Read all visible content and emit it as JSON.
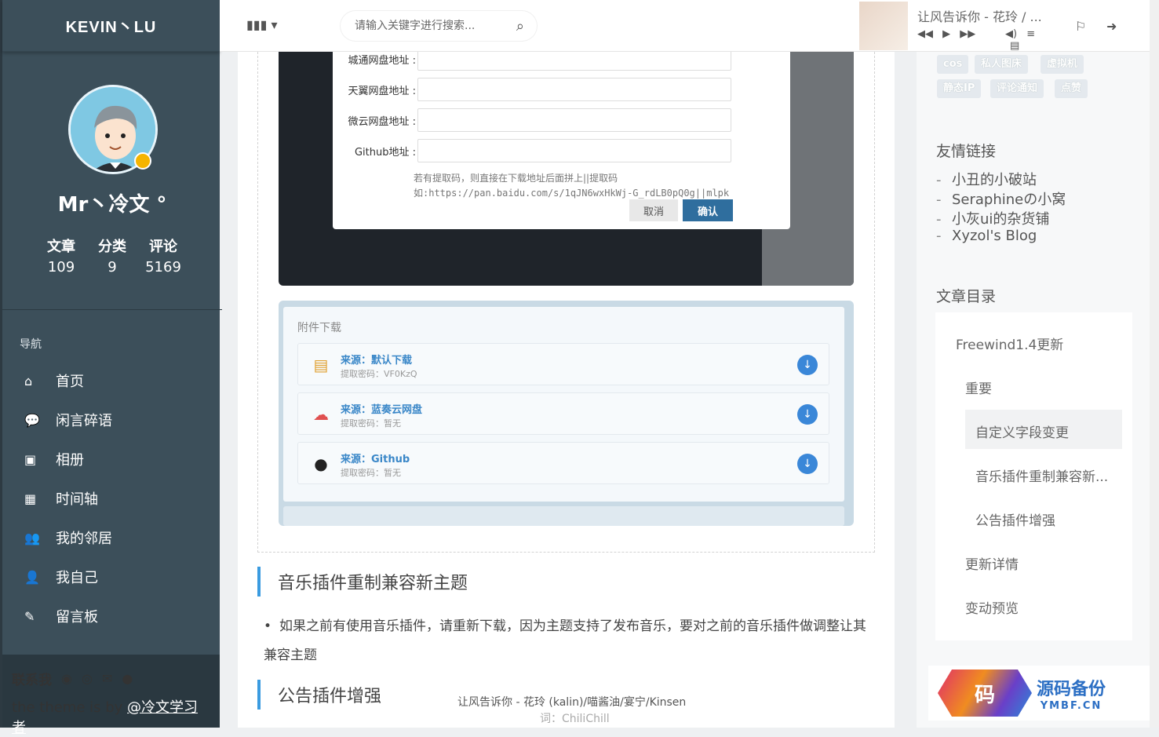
{
  "sidebar": {
    "brand": "KEVIN丶LU",
    "username": "Mr丶冷文 °",
    "stats": [
      {
        "label": "文章",
        "value": "109"
      },
      {
        "label": "分类",
        "value": "9"
      },
      {
        "label": "评论",
        "value": "5169"
      }
    ],
    "nav_heading": "导航",
    "nav": [
      {
        "label": "首页",
        "icon": "home-icon",
        "glyph": "⌂"
      },
      {
        "label": "闲言碎语",
        "icon": "comment-icon",
        "glyph": "💬"
      },
      {
        "label": "相册",
        "icon": "image-icon",
        "glyph": "▣"
      },
      {
        "label": "时间轴",
        "icon": "calendar-icon",
        "glyph": "▦"
      },
      {
        "label": "我的邻居",
        "icon": "users-icon",
        "glyph": "👥"
      },
      {
        "label": "我自己",
        "icon": "user-icon",
        "glyph": "👤"
      },
      {
        "label": "留言板",
        "icon": "edit-icon",
        "glyph": "✎"
      }
    ],
    "contact_label": "联系我",
    "theme_prefix": "the theme is by ",
    "theme_author": "@冷文学习者"
  },
  "topbar": {
    "search_placeholder": "请输入关键字进行搜索...",
    "track_title": "让风告诉你 - 花玲 / ..."
  },
  "dialog": {
    "fields": [
      "城通网盘地址 :",
      "天翼网盘地址 :",
      "微云网盘地址 :",
      "Github地址 :"
    ],
    "hint1": "若有提取码，则直接在下载地址后面拼上||提取码",
    "hint2": "如:https://pan.baidu.com/s/1qJN6wxHkWj-G_rdLB0pQ0g||mlpk",
    "cancel": "取消",
    "confirm": "确认"
  },
  "downloads": {
    "title": "附件下载",
    "items": [
      {
        "source": "来源：默认下载",
        "password": "提取密码：VF0KzQ",
        "icon": "disk-icon"
      },
      {
        "source": "来源：蓝奏云网盘",
        "password": "提取密码：暂无",
        "icon": "cloud-icon"
      },
      {
        "source": "来源：Github",
        "password": "提取密码：暂无",
        "icon": "github-icon"
      }
    ]
  },
  "article": {
    "section1": "音乐插件重制兼容新主题",
    "bullet": "如果之前有使用音乐插件，请重新下载，因为主题支持了发布音乐，要对之前的音乐插件做调整让其兼容主题",
    "section2": "公告插件增强",
    "lyric_line1": "让风告诉你 - 花玲 (kalin)/喵酱油/宴宁/Kinsen",
    "lyric_line2": "词：ChiliChill"
  },
  "right": {
    "tags": [
      "cos",
      "私人图床",
      "虚拟机",
      "静态IP",
      "评论通知",
      "点赞"
    ],
    "friends_heading": "友情链接",
    "friends": [
      "小丑的小破站",
      "Seraphineの小窝",
      "小灰ui的杂货铺",
      "Xyzol's Blog"
    ],
    "toc_heading": "文章目录",
    "toc": [
      {
        "label": "Freewind1.4更新",
        "level": 1
      },
      {
        "label": "重要",
        "level": 2
      },
      {
        "label": "自定义字段变更",
        "level": 3
      },
      {
        "label": "音乐插件重制兼容新...",
        "level": 3
      },
      {
        "label": "公告插件增强",
        "level": 3
      },
      {
        "label": "更新详情",
        "level": 2
      },
      {
        "label": "变动预览",
        "level": 2
      }
    ],
    "toc_active_index": 2
  },
  "watermark": {
    "logo_char": "码",
    "title": "源码备份",
    "subtitle": "YMBF.CN"
  },
  "colors": {
    "sidebar_bg": "#3c4f5a",
    "accent": "#3a9be0",
    "download_button": "#3a87d8"
  }
}
